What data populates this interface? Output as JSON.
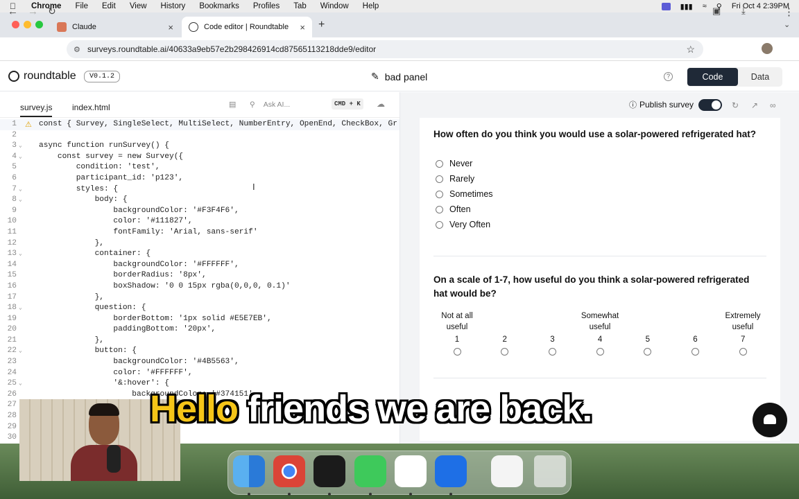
{
  "menubar": {
    "app": "Chrome",
    "items": [
      "File",
      "Edit",
      "View",
      "History",
      "Bookmarks",
      "Profiles",
      "Tab",
      "Window",
      "Help"
    ],
    "datetime": "Fri Oct 4  2:39PM"
  },
  "browser": {
    "tabs": [
      {
        "title": "Claude",
        "active": false
      },
      {
        "title": "Code editor | Roundtable",
        "active": true
      }
    ],
    "new_tab": "+",
    "url": "surveys.roundtable.ai/40633a9eb57e2b298426914cd87565113218dde9/editor"
  },
  "app": {
    "name": "roundtable",
    "version": "V0.1.2",
    "panel_name": "bad panel",
    "help": "?",
    "view_toggle": {
      "code": "Code",
      "data": "Data",
      "selected": "Code"
    }
  },
  "editor": {
    "tabs": [
      "survey.js",
      "index.html"
    ],
    "active_tab": "survey.js",
    "ask_ai_placeholder": "Ask AI...",
    "shortcut": "CMD + K",
    "lines": [
      "const { Survey, SingleSelect, MultiSelect, NumberEntry, OpenEnd, CheckBox, Gr",
      "",
      "async function runSurvey() {",
      "    const survey = new Survey({",
      "        condition: 'test',",
      "        participant_id: 'p123',",
      "        styles: {",
      "            body: {",
      "                backgroundColor: '#F3F4F6',",
      "                color: '#111827',",
      "                fontFamily: 'Arial, sans-serif'",
      "            },",
      "            container: {",
      "                backgroundColor: '#FFFFFF',",
      "                borderRadius: '8px',",
      "                boxShadow: '0 0 15px rgba(0,0,0, 0.1)'",
      "            },",
      "            question: {",
      "                borderBottom: '1px solid #E5E7EB',",
      "                paddingBottom: '20px',",
      "            },",
      "            button: {",
      "                backgroundColor: '#4B5563',",
      "                color: '#FFFFFF',",
      "                '&:hover': {",
      "                    backgroundColor: '#374151'",
      "",
      "",
      "",
      ""
    ]
  },
  "preview": {
    "publish_label": "Publish survey",
    "publish_on": true,
    "questions": [
      {
        "text": "How often do you think you would use a solar-powered refrigerated hat?",
        "options": [
          "Never",
          "Rarely",
          "Sometimes",
          "Often",
          "Very Often"
        ]
      },
      {
        "text": "On a scale of 1-7, how useful do you think a solar-powered refrigerated hat would be?",
        "scale_labels": {
          "low": "Not at all useful",
          "mid": "Somewhat useful",
          "high": "Extremely useful"
        },
        "scale": [
          "1",
          "2",
          "3",
          "4",
          "5",
          "6",
          "7"
        ]
      }
    ]
  },
  "caption": {
    "highlight": "Hello",
    "rest": " friends we are back."
  },
  "colors": {
    "accent_dark": "#1f2937",
    "caption_yellow": "#f5c518"
  }
}
